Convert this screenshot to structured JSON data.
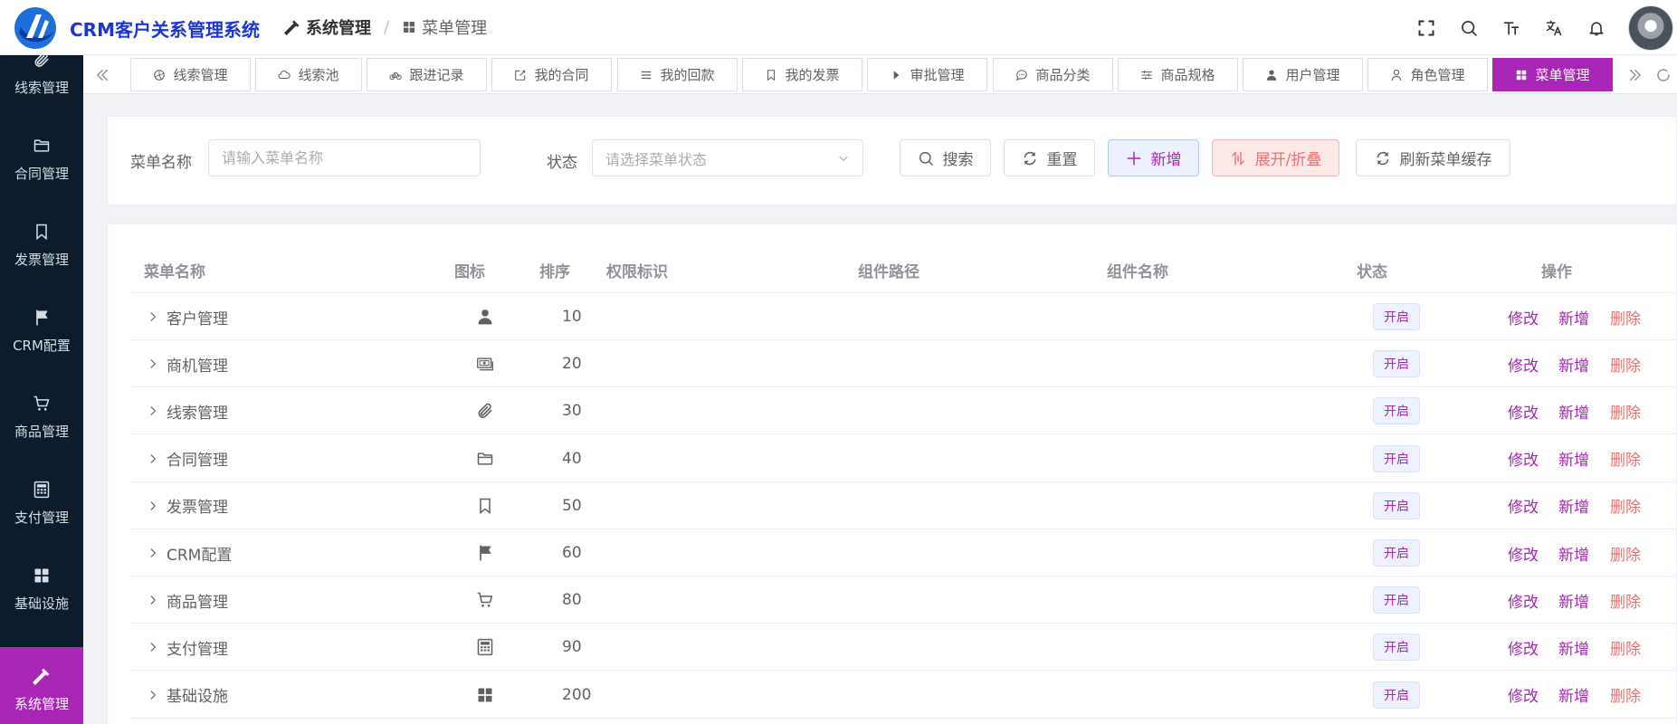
{
  "app": {
    "title": "CRM客户关系管理系统",
    "brand_color": "#1a36d6",
    "accent_color": "#a825b5"
  },
  "breadcrumb": [
    {
      "label": "系统管理",
      "icon": "hammer-icon"
    },
    {
      "label": "菜单管理",
      "icon": "grid-icon"
    }
  ],
  "breadcrumb_separator": "/",
  "header_tools": [
    "fullscreen-icon",
    "search-icon",
    "font-size-icon",
    "translate-icon",
    "bell-icon"
  ],
  "sidebar": {
    "items": [
      {
        "label": "线索管理",
        "icon": "paperclip-icon"
      },
      {
        "label": "合同管理",
        "icon": "folder-icon"
      },
      {
        "label": "发票管理",
        "icon": "bookmark-icon"
      },
      {
        "label": "CRM配置",
        "icon": "flag-icon"
      },
      {
        "label": "商品管理",
        "icon": "cart-icon"
      },
      {
        "label": "支付管理",
        "icon": "calculator-icon"
      },
      {
        "label": "基础设施",
        "icon": "grid-icon"
      },
      {
        "label": "系统管理",
        "icon": "hammer-icon",
        "active": true
      }
    ]
  },
  "tabs": [
    {
      "label": "线索管理",
      "icon": "aperture-icon"
    },
    {
      "label": "线索池",
      "icon": "cloud-icon"
    },
    {
      "label": "跟进记录",
      "icon": "bicycle-icon"
    },
    {
      "label": "我的合同",
      "icon": "edit-icon"
    },
    {
      "label": "我的回款",
      "icon": "list-icon"
    },
    {
      "label": "我的发票",
      "icon": "bookmark-icon"
    },
    {
      "label": "审批管理",
      "icon": "caret-right-icon"
    },
    {
      "label": "商品分类",
      "icon": "chat-icon"
    },
    {
      "label": "商品规格",
      "icon": "sliders-icon"
    },
    {
      "label": "用户管理",
      "icon": "user-filled-icon"
    },
    {
      "label": "角色管理",
      "icon": "user-icon"
    },
    {
      "label": "菜单管理",
      "icon": "grid-icon",
      "active": true
    }
  ],
  "search_form": {
    "name_label": "菜单名称",
    "name_placeholder": "请输入菜单名称",
    "status_label": "状态",
    "status_placeholder": "请选择菜单状态",
    "search_button": "搜索",
    "reset_button": "重置",
    "add_button": "新增",
    "expand_button": "展开/折叠",
    "refresh_button": "刷新菜单缓存"
  },
  "table": {
    "columns": {
      "name": "菜单名称",
      "icon": "图标",
      "sort": "排序",
      "perms": "权限标识",
      "path": "组件路径",
      "component": "组件名称",
      "status": "状态",
      "actions": "操作"
    },
    "rows": [
      {
        "name": "客户管理",
        "icon": "user-filled-icon",
        "sort": "10",
        "perms": "",
        "path": "",
        "component": "",
        "status": "开启",
        "edit": "修改",
        "add": "新增",
        "delete": "删除"
      },
      {
        "name": "商机管理",
        "icon": "money-icon",
        "sort": "20",
        "perms": "",
        "path": "",
        "component": "",
        "status": "开启",
        "edit": "修改",
        "add": "新增",
        "delete": "删除"
      },
      {
        "name": "线索管理",
        "icon": "paperclip-icon",
        "sort": "30",
        "perms": "",
        "path": "",
        "component": "",
        "status": "开启",
        "edit": "修改",
        "add": "新增",
        "delete": "删除"
      },
      {
        "name": "合同管理",
        "icon": "folder-icon",
        "sort": "40",
        "perms": "",
        "path": "",
        "component": "",
        "status": "开启",
        "edit": "修改",
        "add": "新增",
        "delete": "删除"
      },
      {
        "name": "发票管理",
        "icon": "bookmark-icon",
        "sort": "50",
        "perms": "",
        "path": "",
        "component": "",
        "status": "开启",
        "edit": "修改",
        "add": "新增",
        "delete": "删除"
      },
      {
        "name": "CRM配置",
        "icon": "flag-icon",
        "sort": "60",
        "perms": "",
        "path": "",
        "component": "",
        "status": "开启",
        "edit": "修改",
        "add": "新增",
        "delete": "删除"
      },
      {
        "name": "商品管理",
        "icon": "cart-icon",
        "sort": "80",
        "perms": "",
        "path": "",
        "component": "",
        "status": "开启",
        "edit": "修改",
        "add": "新增",
        "delete": "删除"
      },
      {
        "name": "支付管理",
        "icon": "calculator-icon",
        "sort": "90",
        "perms": "",
        "path": "",
        "component": "",
        "status": "开启",
        "edit": "修改",
        "add": "新增",
        "delete": "删除"
      },
      {
        "name": "基础设施",
        "icon": "grid-icon",
        "sort": "200",
        "perms": "",
        "path": "",
        "component": "",
        "status": "开启",
        "edit": "修改",
        "add": "新增",
        "delete": "删除"
      }
    ]
  }
}
